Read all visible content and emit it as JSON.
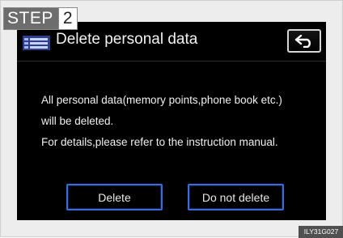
{
  "step": {
    "label": "STEP",
    "number": "2"
  },
  "dialog": {
    "title": "Delete personal data",
    "icon": "settings-list-icon",
    "back_icon": "back-arrow-icon",
    "message_lines": [
      "All personal data(memory points,phone book etc.)",
      "will be deleted.",
      "For details,please refer to the instruction manual."
    ],
    "buttons": {
      "delete_label": "Delete",
      "keep_label": "Do not delete"
    }
  },
  "image_code": "ILY31G027",
  "colors": {
    "button_border": "#3d6bd8",
    "screen_bg": "#000000"
  }
}
